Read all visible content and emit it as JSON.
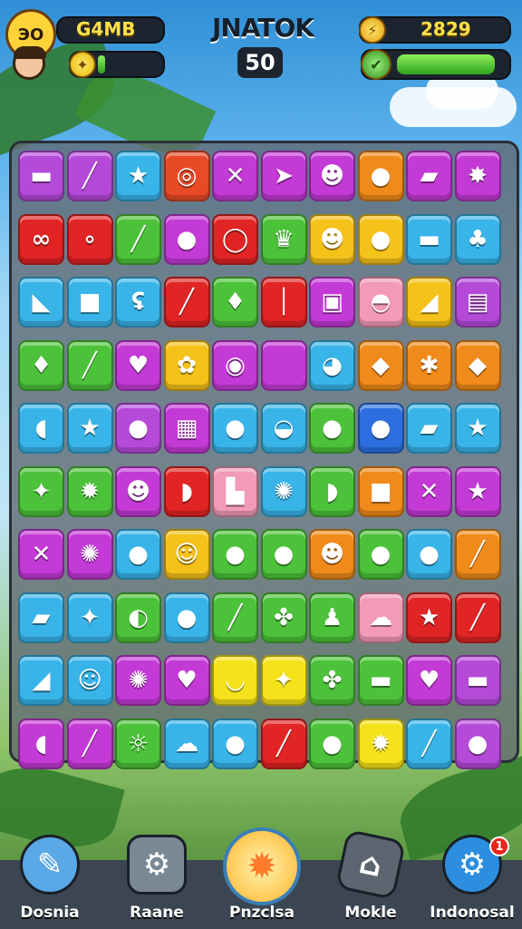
{
  "hud": {
    "level_value": "ЭO",
    "currency_label": "G4MB",
    "title": "JNATOK",
    "moves": "50",
    "score": "2829",
    "energy_fraction": 0.12,
    "health_fraction": 0.9
  },
  "board": {
    "rows": [
      [
        {
          "color": "#b54ad9",
          "icon": "▬"
        },
        {
          "color": "#b54ad9",
          "icon": "╱"
        },
        {
          "color": "#38b4e8",
          "icon": "★"
        },
        {
          "color": "#e84a26",
          "icon": "◎"
        },
        {
          "color": "#c43ad6",
          "icon": "✕"
        },
        {
          "color": "#c43ad6",
          "icon": "➤"
        },
        {
          "color": "#c43ad6",
          "icon": "☻"
        },
        {
          "color": "#f08a1a",
          "icon": "●"
        },
        {
          "color": "#c43ad6",
          "icon": "▰"
        },
        {
          "color": "#c43ad6",
          "icon": "✸"
        }
      ],
      [
        {
          "color": "#e12424",
          "icon": "∞"
        },
        {
          "color": "#e12424",
          "icon": "∘"
        },
        {
          "color": "#4cc23a",
          "icon": "╱"
        },
        {
          "color": "#c43ad6",
          "icon": "●"
        },
        {
          "color": "#e12424",
          "icon": "◯"
        },
        {
          "color": "#4cc23a",
          "icon": "♛"
        },
        {
          "color": "#f5c21a",
          "icon": "☻"
        },
        {
          "color": "#f5c21a",
          "icon": "●"
        },
        {
          "color": "#38b4e8",
          "icon": "▬"
        },
        {
          "color": "#38b4e8",
          "icon": "♣"
        }
      ],
      [
        {
          "color": "#38b4e8",
          "icon": "◣"
        },
        {
          "color": "#38b4e8",
          "icon": "■"
        },
        {
          "color": "#38b4e8",
          "icon": "ʢ"
        },
        {
          "color": "#e12424",
          "icon": "╱"
        },
        {
          "color": "#4cc23a",
          "icon": "♦"
        },
        {
          "color": "#e12424",
          "icon": "│"
        },
        {
          "color": "#c43ad6",
          "icon": "▣"
        },
        {
          "color": "#f29ab8",
          "icon": "◓"
        },
        {
          "color": "#f5c21a",
          "icon": "◢"
        },
        {
          "color": "#b54ad9",
          "icon": "▤"
        }
      ],
      [
        {
          "color": "#4cc23a",
          "icon": "♦"
        },
        {
          "color": "#4cc23a",
          "icon": "╱"
        },
        {
          "color": "#c43ad6",
          "icon": "♥"
        },
        {
          "color": "#f5c21a",
          "icon": "✿"
        },
        {
          "color": "#c43ad6",
          "icon": "◉"
        },
        {
          "color": "#c43ad6",
          "icon": ""
        },
        {
          "color": "#38b4e8",
          "icon": "◕"
        },
        {
          "color": "#f08a1a",
          "icon": "◆"
        },
        {
          "color": "#f08a1a",
          "icon": "✱"
        },
        {
          "color": "#f08a1a",
          "icon": "◆"
        }
      ],
      [
        {
          "color": "#38b4e8",
          "icon": "◖"
        },
        {
          "color": "#38b4e8",
          "icon": "★"
        },
        {
          "color": "#b54ad9",
          "icon": "●"
        },
        {
          "color": "#c43ad6",
          "icon": "▦"
        },
        {
          "color": "#38b4e8",
          "icon": "●"
        },
        {
          "color": "#38b4e8",
          "icon": "◒"
        },
        {
          "color": "#4cc23a",
          "icon": "●"
        },
        {
          "color": "#2d6fe0",
          "icon": "●"
        },
        {
          "color": "#38b4e8",
          "icon": "▰"
        },
        {
          "color": "#38b4e8",
          "icon": "★"
        }
      ],
      [
        {
          "color": "#4cc23a",
          "icon": "✦"
        },
        {
          "color": "#4cc23a",
          "icon": "✹"
        },
        {
          "color": "#c43ad6",
          "icon": "☻"
        },
        {
          "color": "#e12424",
          "icon": "◗"
        },
        {
          "color": "#f29ab8",
          "icon": "▙"
        },
        {
          "color": "#38b4e8",
          "icon": "✺"
        },
        {
          "color": "#4cc23a",
          "icon": "◗"
        },
        {
          "color": "#f08a1a",
          "icon": "■"
        },
        {
          "color": "#c43ad6",
          "icon": "✕"
        },
        {
          "color": "#c43ad6",
          "icon": "★"
        }
      ],
      [
        {
          "color": "#c43ad6",
          "icon": "✕"
        },
        {
          "color": "#c43ad6",
          "icon": "✺"
        },
        {
          "color": "#38b4e8",
          "icon": "●"
        },
        {
          "color": "#f5c21a",
          "icon": "☺"
        },
        {
          "color": "#4cc23a",
          "icon": "●"
        },
        {
          "color": "#4cc23a",
          "icon": "●"
        },
        {
          "color": "#f08a1a",
          "icon": "☻"
        },
        {
          "color": "#4cc23a",
          "icon": "●"
        },
        {
          "color": "#38b4e8",
          "icon": "●"
        },
        {
          "color": "#f08a1a",
          "icon": "╱"
        }
      ],
      [
        {
          "color": "#38b4e8",
          "icon": "▰"
        },
        {
          "color": "#38b4e8",
          "icon": "✦"
        },
        {
          "color": "#4cc23a",
          "icon": "◐"
        },
        {
          "color": "#38b4e8",
          "icon": "●"
        },
        {
          "color": "#4cc23a",
          "icon": "╱"
        },
        {
          "color": "#4cc23a",
          "icon": "✤"
        },
        {
          "color": "#4cc23a",
          "icon": "♟"
        },
        {
          "color": "#f29ab8",
          "icon": "☁"
        },
        {
          "color": "#e12424",
          "icon": "★"
        },
        {
          "color": "#e12424",
          "icon": "╱"
        }
      ],
      [
        {
          "color": "#38b4e8",
          "icon": "◢"
        },
        {
          "color": "#38b4e8",
          "icon": "☺"
        },
        {
          "color": "#c43ad6",
          "icon": "✺"
        },
        {
          "color": "#c43ad6",
          "icon": "♥"
        },
        {
          "color": "#f5e21a",
          "icon": "◡"
        },
        {
          "color": "#f5e21a",
          "icon": "✦"
        },
        {
          "color": "#4cc23a",
          "icon": "✤"
        },
        {
          "color": "#4cc23a",
          "icon": "▬"
        },
        {
          "color": "#c43ad6",
          "icon": "♥"
        },
        {
          "color": "#b54ad9",
          "icon": "▬"
        }
      ],
      [
        {
          "color": "#c43ad6",
          "icon": "◖"
        },
        {
          "color": "#c43ad6",
          "icon": "╱"
        },
        {
          "color": "#4cc23a",
          "icon": "☼"
        },
        {
          "color": "#38b4e8",
          "icon": "☁"
        },
        {
          "color": "#38b4e8",
          "icon": "●"
        },
        {
          "color": "#e12424",
          "icon": "╱"
        },
        {
          "color": "#4cc23a",
          "icon": "●"
        },
        {
          "color": "#f5e21a",
          "icon": "✹"
        },
        {
          "color": "#38b4e8",
          "icon": "╱"
        },
        {
          "color": "#b54ad9",
          "icon": "●"
        }
      ]
    ]
  },
  "nav": {
    "items": [
      {
        "label": "Dosnia",
        "icon": "✎"
      },
      {
        "label": "Raane",
        "icon": "⚙"
      },
      {
        "label": "Pnzclsa",
        "icon": "✹"
      },
      {
        "label": "Mokle",
        "icon": "⌂"
      },
      {
        "label": "Indonosal",
        "icon": "⚙"
      }
    ],
    "notification_count": "1"
  },
  "colors": {
    "accent": "#ffe14a",
    "bar": "#2fa21e",
    "board": "#606870"
  }
}
